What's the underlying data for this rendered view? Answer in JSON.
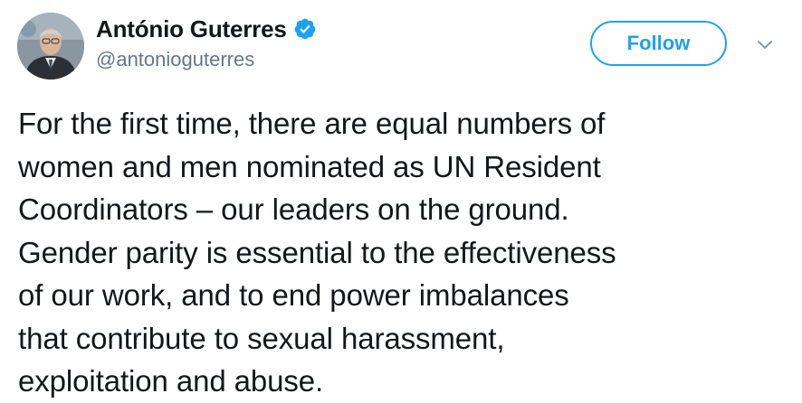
{
  "author": {
    "display_name": "António Guterres",
    "username": "@antonioguterres",
    "verified": true
  },
  "actions": {
    "follow_label": "Follow"
  },
  "icons": {
    "verified": "verified-badge-icon",
    "caret": "chevron-down-icon"
  },
  "tweet": {
    "text": "For the first time, there are equal numbers of\nwomen and men nominated as UN Resident\nCoordinators – our leaders on the ground.\nGender parity is essential to the effectiveness\nof our work, and to end power imbalances\nthat contribute to sexual harassment,\nexploitation and abuse."
  },
  "colors": {
    "accent": "#1da1f2",
    "text": "#14171a",
    "secondary_text": "#657786"
  }
}
